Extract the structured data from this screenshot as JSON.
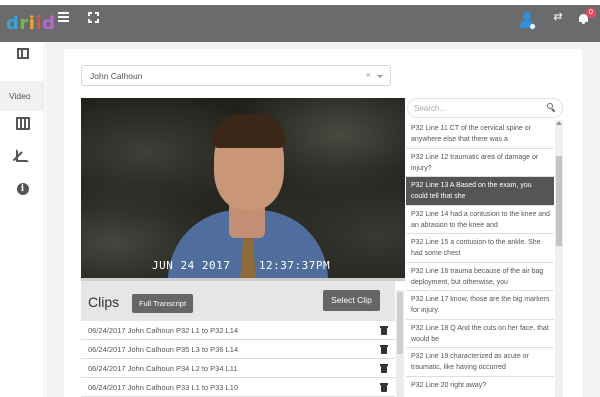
{
  "app": {
    "logo_letters": [
      "d",
      "r",
      "i",
      "i",
      "d"
    ]
  },
  "topbar": {
    "icons": [
      "menu-icon",
      "fullscreen-icon",
      "user-icon",
      "swap-icon",
      "bell-icon"
    ],
    "notification_count": "0",
    "swap_glyph": "⇄"
  },
  "sidebar": {
    "video_label": "Video",
    "info_glyph": "i"
  },
  "witness_select": {
    "value": "John Calhoun",
    "clear_glyph": "×"
  },
  "video": {
    "timestamp": "JUN 24 2017    12:37:37PM",
    "progress": 0.0
  },
  "clips": {
    "title": "Clips",
    "full_transcript_label": "Full Transcript",
    "select_clip_label": "Select Clip",
    "rows": [
      "06/24/2017 John Calhoun P32 L1 to P32 L14",
      "06/24/2017 John Calhoun P35 L3 to P36 L14",
      "06/24/2017 John Calhoun P34 L2 to P34 L11",
      "06/24/2017 John Calhoun P33 L1 to P33 L10"
    ]
  },
  "transcript": {
    "search_placeholder": "Search...",
    "lines": [
      "P32 Line 11 CT of the cervical spine or anywhere else that there was a",
      "P32 Line 12 traumatic area of damage or injury?",
      "P32 Line 13 A Based on the exam, you could tell that she",
      "P32 Line 14 had a contusion to the knee and an abrasion to the knee and",
      "P32 Line 15 a contusion to the ankle. She had some chest",
      "P32 Line 16 trauma because of the air bag deployment, but otherwise, you",
      "P32 Line 17 know, those are the big markers for injury.",
      "P32 Line 18 Q And the cuts on her face, that would be",
      "P32 Line 19 characterized as acute or traumatic, like having occurred",
      "P32 Line 20 right away?"
    ],
    "active_index": 2
  },
  "colors": {
    "topbar": "#6b6b6b",
    "accent": "#2f8fe0",
    "active_line": "#555555",
    "badge": "#e84a5f"
  }
}
